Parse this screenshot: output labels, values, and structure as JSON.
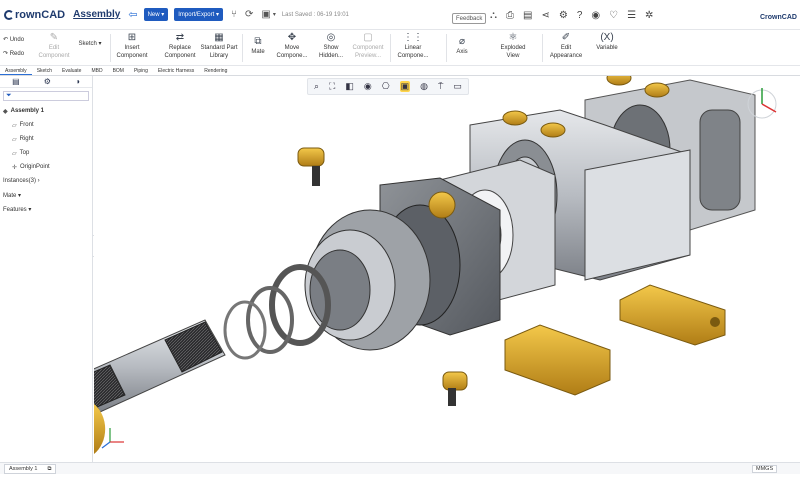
{
  "app": {
    "brand": "rownCAD",
    "document_title": "Assembly",
    "brand_small": "CrownCAD"
  },
  "topbar": {
    "new_label": "New ▾",
    "import_export_label": "Import/Export ▾",
    "saved_text": "Last Saved : 06-19 19:01",
    "feedback_label": "Feedback"
  },
  "ribbon": {
    "undo": "Undo",
    "redo": "Redo",
    "edit_component": "Edit Component",
    "sketch": "Sketch",
    "insert_component": "Insert Component",
    "replace_component": "Replace Component",
    "standard_part_library": "Standard Part Library",
    "mate": "Mate",
    "move_component": "Move Compone...",
    "show_hidden": "Show Hidden...",
    "component_preview": "Component Preview...",
    "linear_component": "Linear Compone...",
    "axis": "Axis",
    "exploded_view": "Exploded View",
    "edit_appearance": "Edit Appearance",
    "variable": "Variable",
    "variable_glyph": "(X)"
  },
  "tabs": [
    "Assembly",
    "Sketch",
    "Evaluate",
    "MBD",
    "BOM",
    "Piping",
    "Electric Harness",
    "Rendering"
  ],
  "tree": {
    "root": "Assembly 1",
    "children": [
      "Front",
      "Right",
      "Top",
      "OriginPoint"
    ],
    "sections": [
      "Instances(3) ›",
      "Mate ▾",
      "Features ▾"
    ]
  },
  "bottom": {
    "tab_label": "Assembly 1",
    "units": "MMGS"
  },
  "colors": {
    "accent": "#1f5bbf",
    "highlight": "#ffd54a",
    "brass": "#d9a52b",
    "steel": "#c9ccd1"
  },
  "icons": [
    "back-arrow-icon",
    "branch-icon",
    "refresh-icon",
    "save-icon",
    "share-icon",
    "print-icon",
    "network-icon",
    "gear-icon",
    "help-icon",
    "palette-icon",
    "like-icon",
    "list-icon",
    "settings-icon"
  ]
}
